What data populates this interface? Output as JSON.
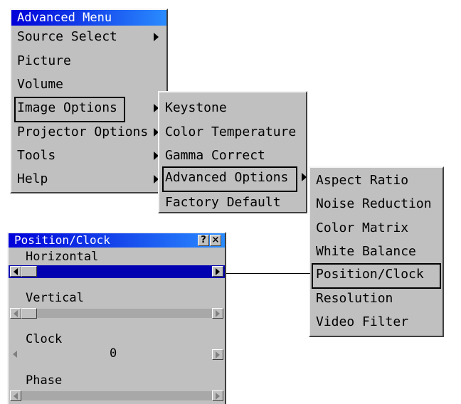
{
  "advanced_menu": {
    "title": "Advanced Menu",
    "items": [
      {
        "label": "Source Select",
        "submenu": true
      },
      {
        "label": "Picture",
        "submenu": false
      },
      {
        "label": "Volume",
        "submenu": false
      },
      {
        "label": "Image Options",
        "submenu": true,
        "selected": true
      },
      {
        "label": "Projector Options",
        "submenu": true
      },
      {
        "label": "Tools",
        "submenu": true
      },
      {
        "label": "Help",
        "submenu": true
      }
    ]
  },
  "image_options_menu": {
    "items": [
      {
        "label": "Keystone",
        "submenu": false
      },
      {
        "label": "Color Temperature",
        "submenu": false
      },
      {
        "label": "Gamma Correct",
        "submenu": false
      },
      {
        "label": "Advanced Options",
        "submenu": true,
        "selected": true
      },
      {
        "label": "Factory Default",
        "submenu": false
      }
    ]
  },
  "advanced_options_menu": {
    "items": [
      {
        "label": "Aspect Ratio"
      },
      {
        "label": "Noise Reduction"
      },
      {
        "label": "Color Matrix"
      },
      {
        "label": "White Balance"
      },
      {
        "label": "Position/Clock",
        "selected": true
      },
      {
        "label": "Resolution"
      },
      {
        "label": "Video Filter"
      }
    ]
  },
  "position_clock": {
    "title": "Position/Clock",
    "help_button": "?",
    "close_button": "×",
    "horizontal_label": "Horizontal",
    "vertical_label": "Vertical",
    "clock_label": "Clock",
    "clock_value": "0",
    "phase_label": "Phase"
  },
  "colors": {
    "title_gradient_start": "#0000d8",
    "title_gradient_end": "#2a8cff",
    "panel_bg": "#c0c0c0",
    "active_bar": "#0000b0"
  }
}
